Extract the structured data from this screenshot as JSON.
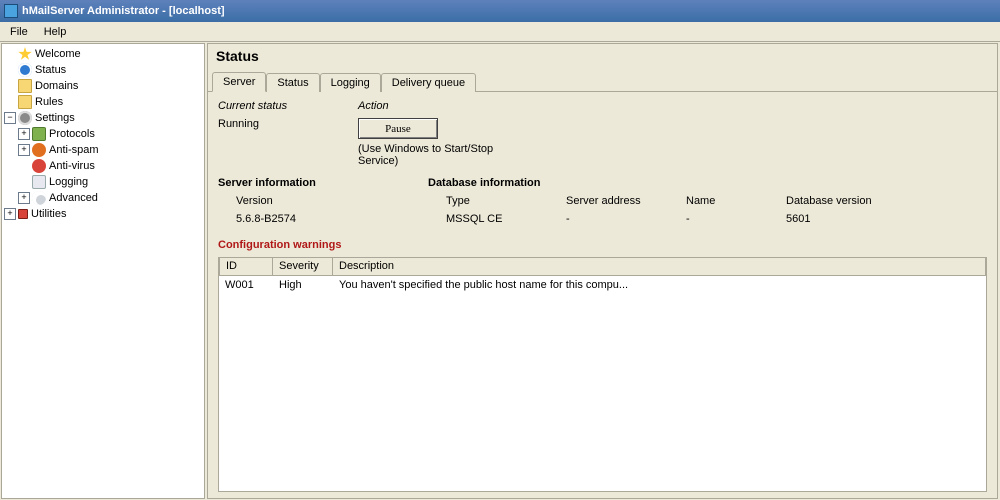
{
  "window": {
    "title": "hMailServer Administrator - [localhost]"
  },
  "menu": {
    "file": "File",
    "help": "Help"
  },
  "tree": {
    "welcome": "Welcome",
    "status": "Status",
    "domains": "Domains",
    "rules": "Rules",
    "settings": "Settings",
    "protocols": "Protocols",
    "antispam": "Anti-spam",
    "antivirus": "Anti-virus",
    "logging": "Logging",
    "advanced": "Advanced",
    "utilities": "Utilities"
  },
  "page": {
    "title": "Status"
  },
  "tabs": {
    "server": "Server",
    "status": "Status",
    "logging": "Logging",
    "delivery": "Delivery queue"
  },
  "server_tab": {
    "current_status_label": "Current status",
    "action_label": "Action",
    "running_label": "Running",
    "pause_button": "Pause",
    "hint": "(Use Windows to Start/Stop Service)",
    "server_info_header": "Server information",
    "db_info_header": "Database information",
    "version_label": "Version",
    "version_value": "5.6.8-B2574",
    "db_type_label": "Type",
    "db_type_value": "MSSQL CE",
    "db_addr_label": "Server address",
    "db_addr_value": "-",
    "db_name_label": "Name",
    "db_name_value": "-",
    "db_ver_label": "Database version",
    "db_ver_value": "5601"
  },
  "warnings": {
    "header": "Configuration warnings",
    "col_id": "ID",
    "col_sev": "Severity",
    "col_desc": "Description",
    "rows": [
      {
        "id": "W001",
        "sev": "High",
        "desc": "You haven't specified the public host name for this compu..."
      }
    ]
  }
}
